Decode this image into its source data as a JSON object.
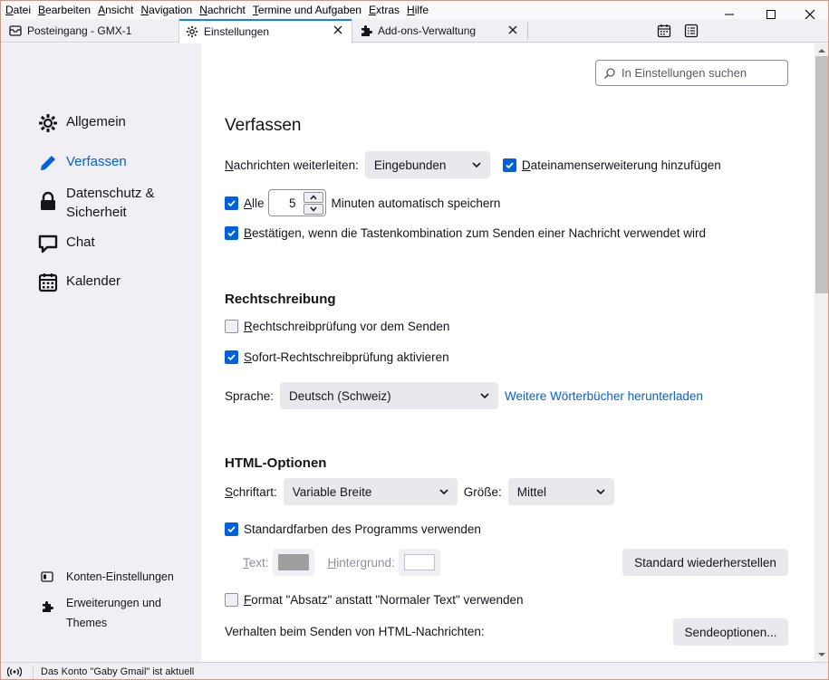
{
  "menubar": [
    "Datei",
    "Bearbeiten",
    "Ansicht",
    "Navigation",
    "Nachricht",
    "Termine und Aufgaben",
    "Extras",
    "Hilfe"
  ],
  "tabs": [
    {
      "label": "Posteingang - GMX-1",
      "icon": "mail-icon"
    },
    {
      "label": "Einstellungen",
      "icon": "gear-icon",
      "active": true
    },
    {
      "label": "Add-ons-Verwaltung",
      "icon": "puzzle-icon"
    }
  ],
  "sidebar": {
    "categories": [
      {
        "label": "Allgemein",
        "icon": "gear-icon"
      },
      {
        "label": "Verfassen",
        "icon": "pencil-icon",
        "selected": true
      },
      {
        "label": "Datenschutz &",
        "label2": "Sicherheit",
        "icon": "lock-icon"
      },
      {
        "label": "Chat",
        "icon": "chat-icon"
      },
      {
        "label": "Kalender",
        "icon": "calendar-icon"
      }
    ],
    "footer": [
      {
        "label": "Konten-Einstellungen",
        "icon": "account-icon"
      },
      {
        "label": "Erweiterungen und",
        "label2": "Themes",
        "icon": "puzzle-icon"
      }
    ]
  },
  "search": {
    "placeholder": "In Einstellungen suchen"
  },
  "compose": {
    "title": "Verfassen",
    "forward_label": "Nachrichten weiterleiten:",
    "forward_value": "Eingebunden",
    "extension_label": "Dateinamenserweiterung hinzufügen",
    "extension_checked": true,
    "autosave_prefix": "Alle",
    "autosave_value": "5",
    "autosave_suffix": "Minuten automatisch speichern",
    "autosave_checked": true,
    "confirm_label": "Bestätigen, wenn die Tastenkombination zum Senden einer Nachricht verwendet wird",
    "confirm_checked": true
  },
  "spelling": {
    "title": "Rechtschreibung",
    "check_before_send": "Rechtschreibprüfung vor dem Senden",
    "check_before_send_checked": false,
    "instant_check": "Sofort-Rechtschreibprüfung aktivieren",
    "instant_check_checked": true,
    "language_label": "Sprache:",
    "language_value": "Deutsch (Schweiz)",
    "more_dictionaries": "Weitere Wörterbücher herunterladen"
  },
  "html_options": {
    "title": "HTML-Optionen",
    "font_label": "Schriftart:",
    "font_value": "Variable Breite",
    "size_label": "Größe:",
    "size_value": "Mittel",
    "default_colors": "Standardfarben des Programms verwenden",
    "default_colors_checked": true,
    "text_label": "Text:",
    "background_label": "Hintergrund:",
    "text_color": "#9e9e9e",
    "background_color": "#ffffff",
    "restore_button": "Standard wiederherstellen",
    "paragraph_format": "Format \"Absatz\" anstatt \"Normaler Text\" verwenden",
    "paragraph_format_checked": false,
    "send_behavior_label": "Verhalten beim Senden von HTML-Nachrichten:",
    "send_options_button": "Sendeoptionen..."
  },
  "status": {
    "text": "Das Konto \"Gaby Gmail\" ist aktuell"
  },
  "colors": {
    "accent": "#0061e0",
    "tab_indicator": "#0a84ff",
    "sidebar_bg": "#f0f0f4"
  }
}
